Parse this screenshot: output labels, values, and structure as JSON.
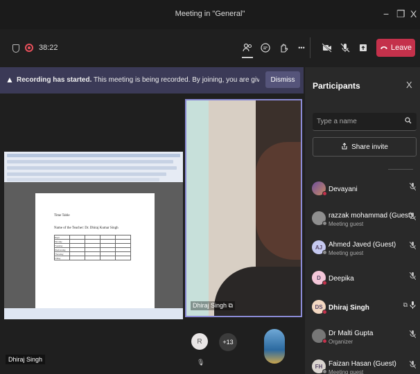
{
  "window": {
    "title": "Meeting in \"General\"",
    "minimize": "−",
    "restore": "❐",
    "close": "X"
  },
  "toolbar": {
    "timer": "38:22",
    "leave_label": "Leave",
    "more": "•••"
  },
  "banner": {
    "bold": "Recording has started.",
    "message": " This meeting is being recorded. By joining, you are giving consent for this meeti...",
    "dismiss": "Dismiss"
  },
  "stage": {
    "screen_share_doc": {
      "title": "Time Table",
      "subtitle": "Name of the Teacher: Dr. Dhiraj Kumar Singh",
      "rows": [
        "Days",
        "Monday",
        "Tuesday",
        "Wednesday",
        "Thursday",
        "Friday"
      ]
    },
    "camera_name": "Dhiraj Singh",
    "bottom_name": "Dhiraj Singh",
    "avatar_initial": "R",
    "overflow_count": "+13"
  },
  "panel": {
    "title": "Participants",
    "close": "X",
    "search_placeholder": "Type a name",
    "share_invite": "Share invite",
    "participants": [
      {
        "name": "Devayani",
        "sub": "",
        "initials": "",
        "avatar_color": "",
        "status_color": "#c4314b",
        "bold": false
      },
      {
        "name": "razzak mohammad (Guest)",
        "sub": "Meeting guest",
        "initials": "",
        "avatar_color": "#8f8f8f",
        "status_color": "#8a8a8a",
        "bold": false
      },
      {
        "name": "Ahmed Javed (Guest)",
        "sub": "Meeting guest",
        "initials": "AJ",
        "avatar_color": "#c5c9f0",
        "status_color": "#8a8a8a",
        "bold": false
      },
      {
        "name": "Deepika",
        "sub": "",
        "initials": "D",
        "avatar_color": "#f4c7d9",
        "status_color": "#c4314b",
        "bold": false
      },
      {
        "name": "Dhiraj Singh",
        "sub": "",
        "initials": "DS",
        "avatar_color": "#f3d7c1",
        "status_color": "#c4314b",
        "bold": true
      },
      {
        "name": "Dr Malti Gupta",
        "sub": "Organizer",
        "initials": "",
        "avatar_color": "#777777",
        "status_color": "#c4314b",
        "bold": false
      },
      {
        "name": "Faizan Hasan (Guest)",
        "sub": "Meeting guest",
        "initials": "FH",
        "avatar_color": "#d9d4cf",
        "status_color": "#8a8a8a",
        "bold": false
      }
    ]
  },
  "colors": {
    "leave": "#c4314b",
    "banner": "#3b3a57",
    "active_border": "#8b8bd6"
  }
}
